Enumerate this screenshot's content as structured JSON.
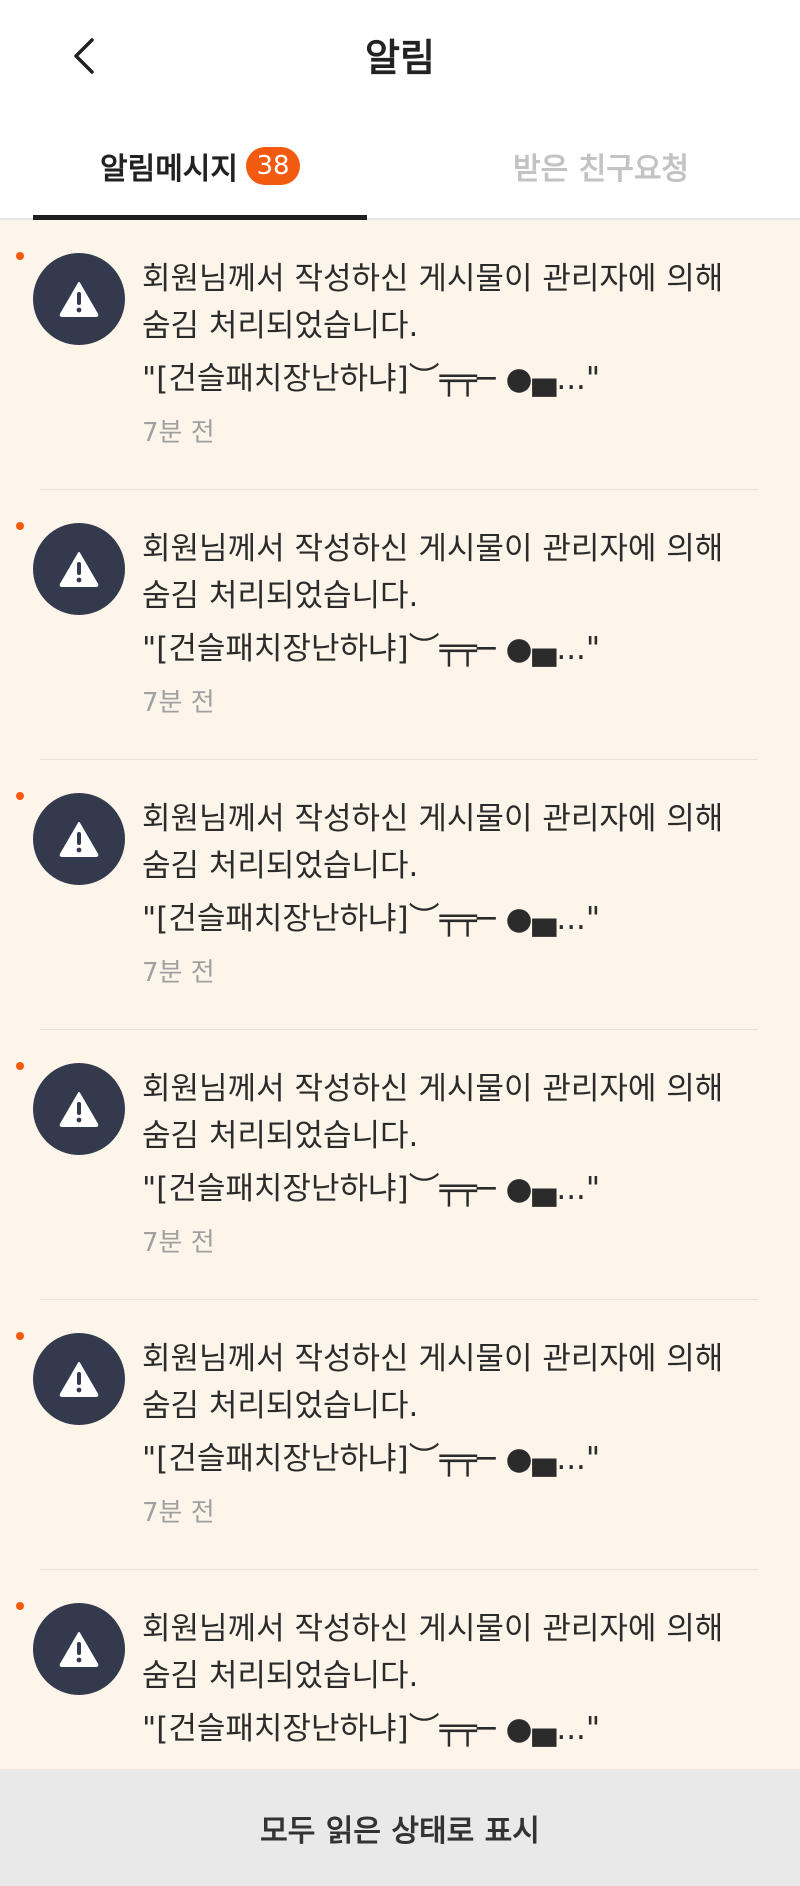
{
  "header": {
    "title": "알림",
    "back_icon": "chevron-left-icon"
  },
  "tabs": [
    {
      "label": "알림메시지",
      "badge": "38",
      "active": true
    },
    {
      "label": "받은 친구요청",
      "active": false
    }
  ],
  "notifications": [
    {
      "icon": "warning-icon",
      "message": "회원님께서 작성하신 게시물이 관리자에 의해 숨김 처리되었습니다.",
      "quote": "\"[건슬패치장난하냐]︶╤╤─ ●▄...\"",
      "time": "7분 전",
      "unread": true
    },
    {
      "icon": "warning-icon",
      "message": "회원님께서 작성하신 게시물이 관리자에 의해 숨김 처리되었습니다.",
      "quote": "\"[건슬패치장난하냐]︶╤╤─ ●▄...\"",
      "time": "7분 전",
      "unread": true
    },
    {
      "icon": "warning-icon",
      "message": "회원님께서 작성하신 게시물이 관리자에 의해 숨김 처리되었습니다.",
      "quote": "\"[건슬패치장난하냐]︶╤╤─ ●▄...\"",
      "time": "7분 전",
      "unread": true
    },
    {
      "icon": "warning-icon",
      "message": "회원님께서 작성하신 게시물이 관리자에 의해 숨김 처리되었습니다.",
      "quote": "\"[건슬패치장난하냐]︶╤╤─ ●▄...\"",
      "time": "7분 전",
      "unread": true
    },
    {
      "icon": "warning-icon",
      "message": "회원님께서 작성하신 게시물이 관리자에 의해 숨김 처리되었습니다.",
      "quote": "\"[건슬패치장난하냐]︶╤╤─ ●▄...\"",
      "time": "7분 전",
      "unread": true
    },
    {
      "icon": "warning-icon",
      "message": "회원님께서 작성하신 게시물이 관리자에 의해 숨김 처리되었습니다.",
      "quote": "\"[건슬패치장난하냐]︶╤╤─ ●▄...\"",
      "time": "",
      "unread": true
    }
  ],
  "footer": {
    "mark_all_read_label": "모두 읽은 상태로 표시"
  },
  "colors": {
    "accent": "#f25a0f",
    "background": "#fdf5ea",
    "avatar_bg": "#333a4d"
  }
}
